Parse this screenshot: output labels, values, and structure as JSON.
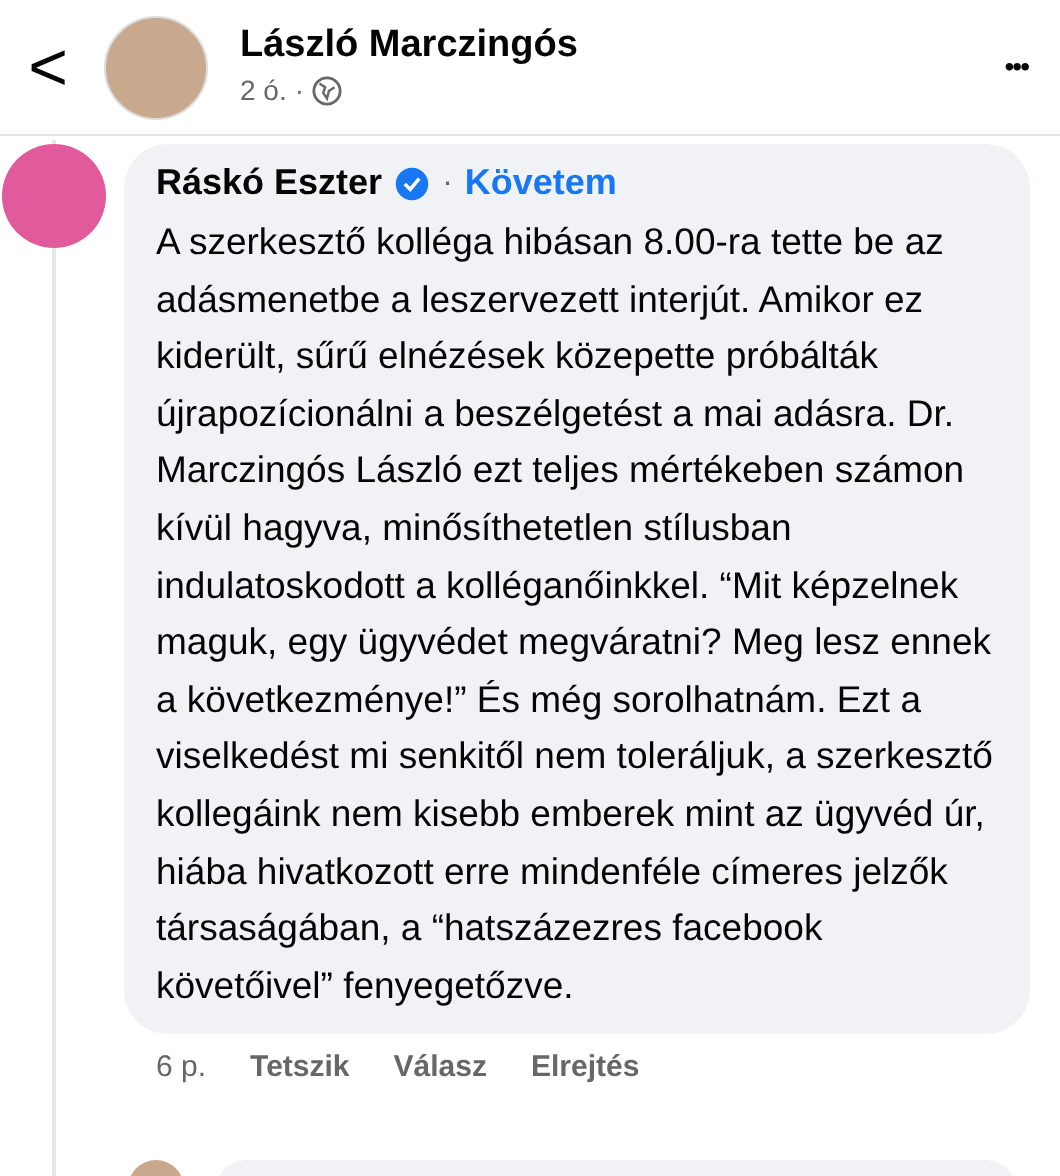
{
  "header": {
    "back": "<",
    "author": "László Marczingós",
    "time": "2 ó.",
    "separator": "·",
    "more": "•••"
  },
  "comment": {
    "author": "Ráskó Eszter",
    "verified": true,
    "separator": "·",
    "follow": "Követem",
    "text": "A szerkesztő kolléga hibásan 8.00-ra tette be az adásmenetbe a leszervezett interjút. Amikor ez kiderült, sűrű elnézések közepette próbálták újrapozícionálni a beszélgetést a mai adásra. Dr. Marczingós László ezt teljes mértékeben számon kívül hagyva, minősíthetetlen stílusban indulatoskodott a kolléganőinkkel. “Mit képzelnek maguk, egy ügyvédet megváratni? Meg lesz ennek a következménye!” És még sorolhatnám. Ezt a viselkedést mi senkitől nem toleráljuk, a szerkesztő kollegáink nem kisebb emberek mint az ügyvéd úr, hiába hivatkozott erre mindenféle címeres jelzők társaságában, a “hatszázezres facebook követőivel” fenyegetőzve.",
    "time": "6 p.",
    "actions": [
      "Tetszik",
      "Válasz",
      "Elrejtés"
    ]
  }
}
